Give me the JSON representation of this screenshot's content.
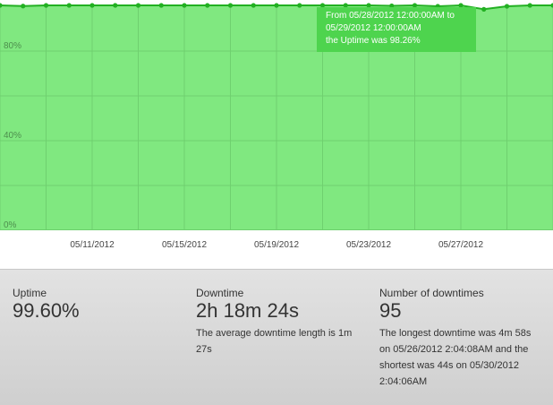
{
  "chart_data": {
    "type": "area",
    "y_tick_labels": [
      "80%",
      "40%",
      "0%"
    ],
    "ylim": [
      0,
      100
    ],
    "x_tick_labels": [
      "05/11/2012",
      "05/15/2012",
      "05/19/2012",
      "05/23/2012",
      "05/27/2012"
    ],
    "grid": true,
    "series": [
      {
        "dates": [
          "05/07/2012",
          "05/08/2012",
          "05/09/2012",
          "05/10/2012",
          "05/11/2012",
          "05/12/2012",
          "05/13/2012",
          "05/14/2012",
          "05/15/2012",
          "05/16/2012",
          "05/17/2012",
          "05/18/2012",
          "05/19/2012",
          "05/20/2012",
          "05/21/2012",
          "05/22/2012",
          "05/23/2012",
          "05/24/2012",
          "05/25/2012",
          "05/26/2012",
          "05/27/2012",
          "05/28/2012",
          "05/29/2012",
          "05/30/2012",
          "05/31/2012"
        ],
        "values": [
          100,
          99.7,
          100,
          100,
          100,
          100,
          100,
          100,
          100,
          100,
          100,
          100,
          100,
          100,
          100,
          100,
          100,
          99.8,
          100,
          99.6,
          100,
          98.26,
          99.6,
          100,
          100
        ]
      }
    ],
    "colors": {
      "area": "#80e880",
      "line": "#22b022",
      "tooltip": "#4ed44e"
    }
  },
  "tooltip": {
    "line1": "From 05/28/2012 12:00:00AM to",
    "line2": "05/29/2012 12:00:00AM",
    "line3": "the Uptime was 98.26%"
  },
  "stats": {
    "uptime": {
      "label": "Uptime",
      "value": "99.60%"
    },
    "downtime": {
      "label": "Downtime",
      "value": "2h 18m 24s",
      "note": "The average downtime length is 1m 27s"
    },
    "count": {
      "label": "Number of downtimes",
      "value": "95",
      "note": "The longest downtime was 4m 58s on 05/26/2012 2:04:08AM and the shortest was 44s on 05/30/2012 2:04:06AM"
    }
  }
}
